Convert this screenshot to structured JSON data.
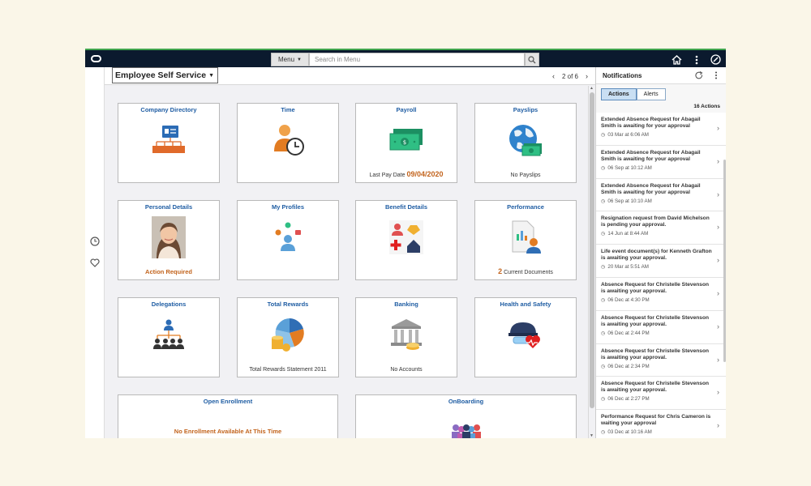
{
  "topbar": {
    "menu_label": "Menu",
    "search_placeholder": "Search in Menu"
  },
  "home": {
    "page_title": "Employee Self Service",
    "pager_text": "2 of 6"
  },
  "tiles": {
    "company_directory": {
      "title": "Company Directory"
    },
    "time": {
      "title": "Time"
    },
    "payroll": {
      "title": "Payroll",
      "footer_label": "Last Pay Date",
      "footer_value": "09/04/2020"
    },
    "payslips": {
      "title": "Payslips",
      "footer": "No Payslips"
    },
    "personal_details": {
      "title": "Personal Details",
      "footer": "Action Required"
    },
    "my_profiles": {
      "title": "My Profiles"
    },
    "benefit_details": {
      "title": "Benefit Details"
    },
    "performance": {
      "title": "Performance",
      "footer_count": "2",
      "footer_label": "Current Documents"
    },
    "delegations": {
      "title": "Delegations"
    },
    "total_rewards": {
      "title": "Total Rewards",
      "footer": "Total Rewards Statement 2011"
    },
    "banking": {
      "title": "Banking",
      "footer": "No Accounts"
    },
    "health_safety": {
      "title": "Health and Safety"
    },
    "open_enrollment": {
      "title": "Open Enrollment",
      "message": "No Enrollment Available At This Time"
    },
    "onboarding": {
      "title": "OnBoarding"
    }
  },
  "notifications": {
    "title": "Notifications",
    "tab_actions": "Actions",
    "tab_alerts": "Alerts",
    "count_label": "16 Actions",
    "items": [
      {
        "text": "Extended Absence Request for Abagail Smith is awaiting for your approval",
        "date": "03 Mar at 6:06 AM"
      },
      {
        "text": "Extended Absence Request for Abagail Smith is awaiting for your approval",
        "date": "06 Sep at 10:12 AM"
      },
      {
        "text": "Extended Absence Request for Abagail Smith is awaiting for your approval",
        "date": "06 Sep at 10:10 AM"
      },
      {
        "text": "Resignation request from David Michelson is pending your approval.",
        "date": "14 Jun at 8:44 AM"
      },
      {
        "text": "Life event document(s) for Kenneth Grafton is awaiting your approval.",
        "date": "20 Mar at 5:51 AM"
      },
      {
        "text": "Absence Request for Christelle Stevenson is awaiting your approval.",
        "date": "06 Dec at 4:30 PM"
      },
      {
        "text": "Absence Request for Christelle Stevenson is awaiting your approval.",
        "date": "06 Dec at 2:44 PM"
      },
      {
        "text": "Absence Request for Christelle Stevenson is awaiting your approval.",
        "date": "06 Dec at 2:34 PM"
      },
      {
        "text": "Absence Request for Christelle Stevenson is awaiting your approval.",
        "date": "06 Dec at 2:27 PM"
      },
      {
        "text": "Performance Request for Chris Cameron is waiting your approval",
        "date": "03 Dec at 10:16 AM"
      }
    ]
  },
  "colors": {
    "topbar": "#0b1a2e",
    "tile_title": "#1f5da3",
    "warning_orange": "#c2631c"
  }
}
